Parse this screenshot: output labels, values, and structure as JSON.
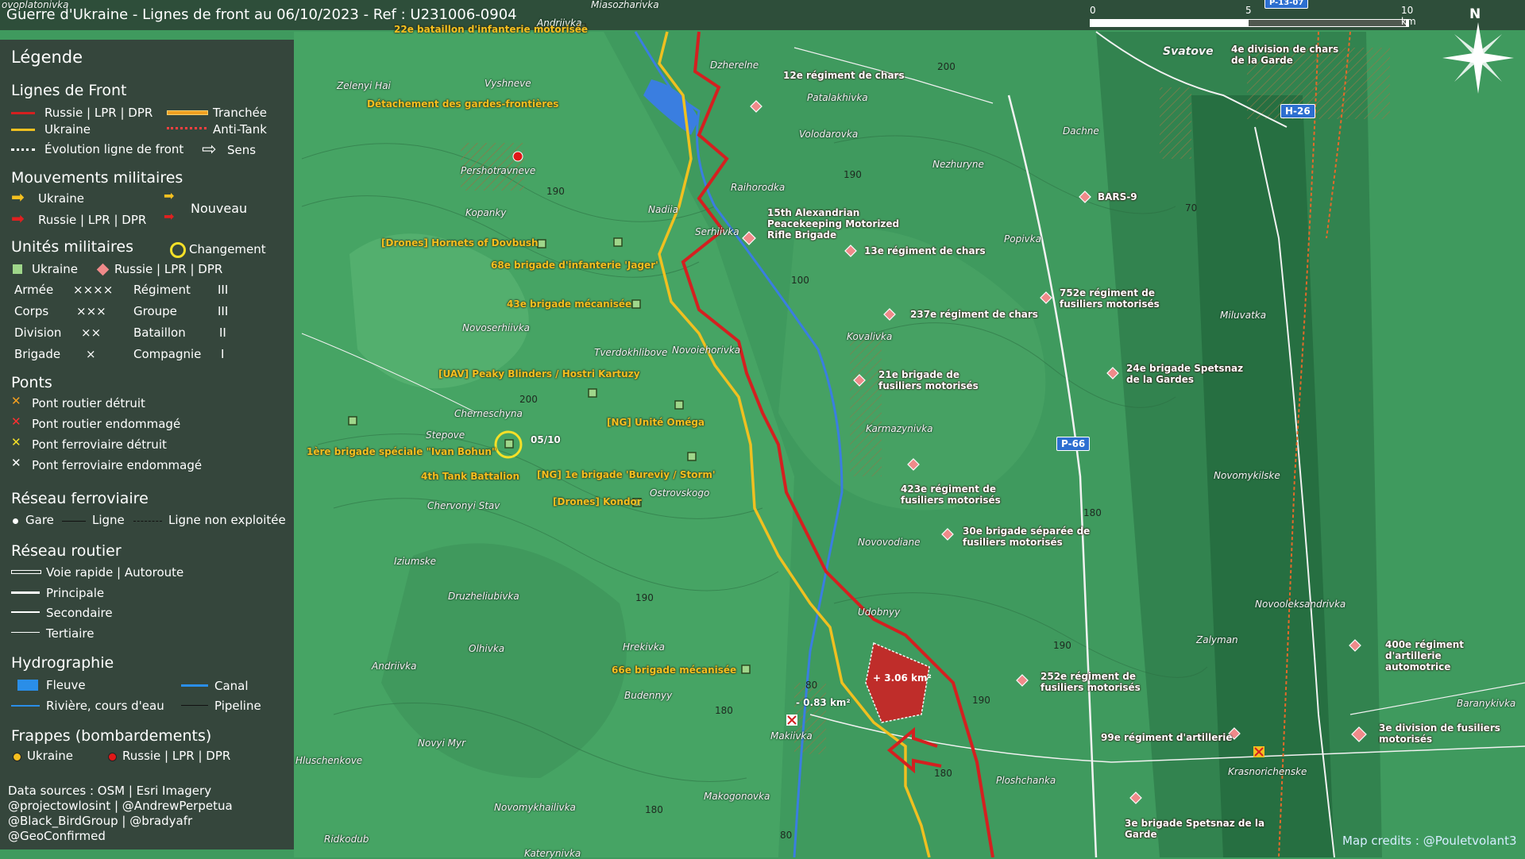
{
  "header": {
    "title": "Guerre d'Ukraine - Lignes de front au 06/10/2023 - Ref : U231006-0904",
    "scale_0": "0",
    "scale_5": "5",
    "scale_10": "10 km",
    "north": "N"
  },
  "legend": {
    "title": "Légende",
    "front_lines": {
      "title": "Lignes de Front",
      "russia": "Russie | LPR | DPR",
      "ukraine": "Ukraine",
      "evolution": "Évolution ligne de front",
      "trench": "Tranchée",
      "antitank": "Anti-Tank",
      "direction": "Sens"
    },
    "movements": {
      "title": "Mouvements militaires",
      "ukraine": "Ukraine",
      "russia": "Russie | LPR | DPR",
      "new": "Nouveau"
    },
    "units": {
      "title": "Unités militaires",
      "change": "Changement",
      "ukraine": "Ukraine",
      "russia": "Russie | LPR | DPR",
      "rows": [
        {
          "a": "Armée",
          "as": "××××",
          "b": "Régiment",
          "bs": "III"
        },
        {
          "a": "Corps",
          "as": "×××",
          "b": "Groupe",
          "bs": "III"
        },
        {
          "a": "Division",
          "as": "××",
          "b": "Bataillon",
          "bs": "II"
        },
        {
          "a": "Brigade",
          "as": "×",
          "b": "Compagnie",
          "bs": "I"
        }
      ]
    },
    "bridges": {
      "title": "Ponts",
      "items": [
        "Pont routier détruit",
        "Pont routier endommagé",
        "Pont ferroviaire détruit",
        "Pont ferroviaire endommagé"
      ]
    },
    "rail": {
      "title": "Réseau ferroviaire",
      "station": "Gare",
      "line": "Ligne",
      "unused": "Ligne non exploitée"
    },
    "roads": {
      "title": "Réseau routier",
      "items": [
        "Voie rapide | Autoroute",
        "Principale",
        "Secondaire",
        "Tertiaire"
      ]
    },
    "hydro": {
      "title": "Hydrographie",
      "river_big": "Fleuve",
      "canal": "Canal",
      "stream": "Rivière, cours d'eau",
      "pipeline": "Pipeline"
    },
    "strikes": {
      "title": "Frappes (bombardements)",
      "ukraine": "Ukraine",
      "russia": "Russie | LPR | DPR"
    },
    "sources": [
      "Data sources : OSM | Esri Imagery",
      "@projectowlosint | @AndrewPerpetua",
      "@Black_BirdGroup | @bradyafr",
      "@GeoConfirmed"
    ]
  },
  "map": {
    "places": [
      "ovoplatonivka",
      "Miasozharivka",
      "Andriivka",
      "Zelenyi Hai",
      "Vyshneve",
      "Dzherelne",
      "Patalakhivka",
      "Svatove",
      "Pershotravneve",
      "Volodarovka",
      "Dachne",
      "Raihorodka",
      "Nezhuryne",
      "Kopanky",
      "Nadiia",
      "Serhiivka",
      "Popivka",
      "Novoserhiivka",
      "Tverdokhlibove",
      "Novoiehorivka",
      "Kovalivka",
      "Miluvatka",
      "Cherneschyna",
      "Stepove",
      "Karmazynivka",
      "Ostrovskogo",
      "Chervonyi Stav",
      "Novomykilske",
      "Iziumske",
      "Novovodiane",
      "Druzheliubivka",
      "Udobnyy",
      "Novooleksandrivka",
      "Olhivka",
      "Hrekivka",
      "Zalyman",
      "Andriivka",
      "Budennyy",
      "Baranykivka",
      "Makiivka",
      "Hluschenkove",
      "Novyi Myr",
      "Krasnorichenske",
      "Ploshchanka",
      "Makogonovka",
      "Novomykhailivka",
      "Ridkodub",
      "Katerynivka"
    ],
    "elevations": [
      "200",
      "190",
      "190",
      "100",
      "200",
      "70",
      "180",
      "190",
      "190",
      "80",
      "180",
      "190",
      "180",
      "180",
      "80"
    ],
    "ua_units": [
      "22e bataillon d'infanterie motorisée",
      "Détachement des gardes-frontières",
      "[Drones] Hornets of Dovbush",
      "68e brigade d'infanterie 'Jager'",
      "43e brigade mécanisée",
      "[UAV] Peaky Blinders / Hostri Kartuzy",
      "[NG] Unité Oméga",
      "1ère brigade spéciale \"Ivan Bohun\"",
      "4th Tank Battalion",
      "[NG] 1e brigade 'Bureviy / Storm'",
      "[Drones] Kondor",
      "66e brigade mécanisée"
    ],
    "ru_units": [
      "12e régiment de chars",
      "4e division de chars de la Garde",
      "BARS-9",
      "15th Alexandrian Peacekeeping Motorized Rifle Brigade",
      "13e régiment de chars",
      "237e régiment de chars",
      "752e régiment de fusiliers motorisés",
      "24e brigade Spetsnaz de la Gardes",
      "21e brigade de fusiliers motorisés",
      "423e régiment de fusiliers motorisés",
      "30e brigade séparée de fusiliers motorisés",
      "400e régiment d'artillerie automotrice",
      "252e régiment de fusiliers motorisés",
      "99e régiment d'artillerie",
      "3e division de fusiliers motorisés",
      "3e brigade Spetsnaz de la Garde"
    ],
    "roads": [
      "H-26",
      "P-66",
      "P-13-07"
    ],
    "change_date": "05/10",
    "gain": "+ 3.06 km²",
    "loss": "- 0.83 km²",
    "credit": "Map credits : @Pouletvolant3"
  },
  "colors": {
    "russia_line": "#d42020",
    "ukraine_line": "#f0c020",
    "legend_bg": "#343a38",
    "river": "#3a7ee0"
  }
}
